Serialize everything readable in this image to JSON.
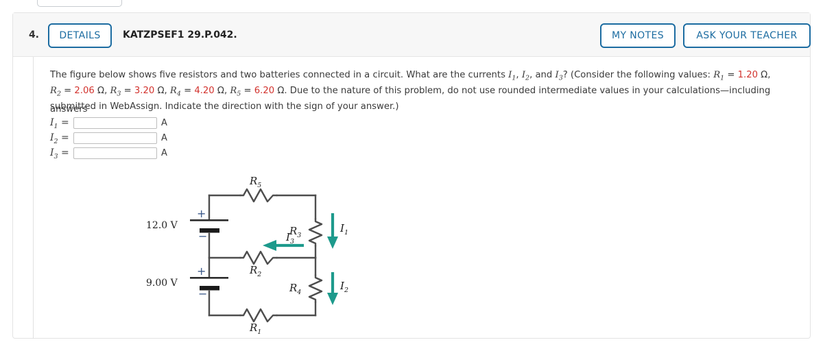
{
  "header": {
    "question_number": "4.",
    "details_label": "DETAILS",
    "question_code": "KATZPSEF1 29.P.042.",
    "my_notes_label": "MY NOTES",
    "ask_teacher_label": "ASK YOUR TEACHER",
    "accent_color": "#1c6ca1",
    "background": "#f7f7f7"
  },
  "problem": {
    "line1_a": "The figure below shows five resistors and two batteries connected in a circuit. What are the currents ",
    "line1_i1": "I",
    "line1_i1sub": "1",
    "line1_b": ", ",
    "line1_i2": "I",
    "line1_i2sub": "2",
    "line1_c": ", and ",
    "line1_i3": "I",
    "line1_i3sub": "3",
    "line1_d": "? (Consider the following values: ",
    "line1_r1": "R",
    "line1_r1sub": "1",
    "line1_eq1": " = ",
    "line1_v1": "1.20",
    "line1_ohm1": " Ω,",
    "line2_r2": "R",
    "line2_r2sub": "2",
    "line2_eq2": " = ",
    "line2_v2": "2.06",
    "line2_ohm2": " Ω, ",
    "line2_r3": "R",
    "line2_r3sub": "3",
    "line2_eq3": " = ",
    "line2_v3": "3.20",
    "line2_ohm3": " Ω, ",
    "line2_r4": "R",
    "line2_r4sub": "4",
    "line2_eq4": " = ",
    "line2_v4": "4.20",
    "line2_ohm4": " Ω, ",
    "line2_r5": "R",
    "line2_r5sub": "5",
    "line2_eq5": " = ",
    "line2_v5": "6.20",
    "line2_ohm5": " Ω. Due to the nature of this problem, do not use rounded intermediate values in your calculations—including answers",
    "line3": "submitted in WebAssign. Indicate the direction with the sign of your answer.)",
    "red_color": "#d2322d"
  },
  "answers": [
    {
      "symbol": "I",
      "sub": "1",
      "eq": " =",
      "value": "",
      "placeholder": "",
      "unit": "A"
    },
    {
      "symbol": "I",
      "sub": "2",
      "eq": " =",
      "value": "",
      "placeholder": "",
      "unit": "A"
    },
    {
      "symbol": "I",
      "sub": "3",
      "eq": " =",
      "value": "",
      "placeholder": "",
      "unit": "A"
    }
  ],
  "figure": {
    "title": "circuit-diagram",
    "wire_color": "#4d4d4d",
    "arrow_color": "#1d9a8c",
    "battery1_label": "12.0 V",
    "battery1_plus": "+",
    "battery1_minus": "−",
    "battery2_label": "9.00 V",
    "battery2_plus": "+",
    "battery2_minus": "−",
    "resistors": [
      {
        "name": "R",
        "sub": "1",
        "position": "bottom"
      },
      {
        "name": "R",
        "sub": "2",
        "position": "middle"
      },
      {
        "name": "R",
        "sub": "3",
        "position": "right-upper"
      },
      {
        "name": "R",
        "sub": "4",
        "position": "right-lower"
      },
      {
        "name": "R",
        "sub": "5",
        "position": "top"
      }
    ],
    "currents": [
      {
        "name": "I",
        "sub": "1",
        "direction": "down",
        "position": "right-upper"
      },
      {
        "name": "I",
        "sub": "2",
        "direction": "down",
        "position": "right-lower"
      },
      {
        "name": "I",
        "sub": "3",
        "direction": "left",
        "position": "middle"
      }
    ]
  }
}
